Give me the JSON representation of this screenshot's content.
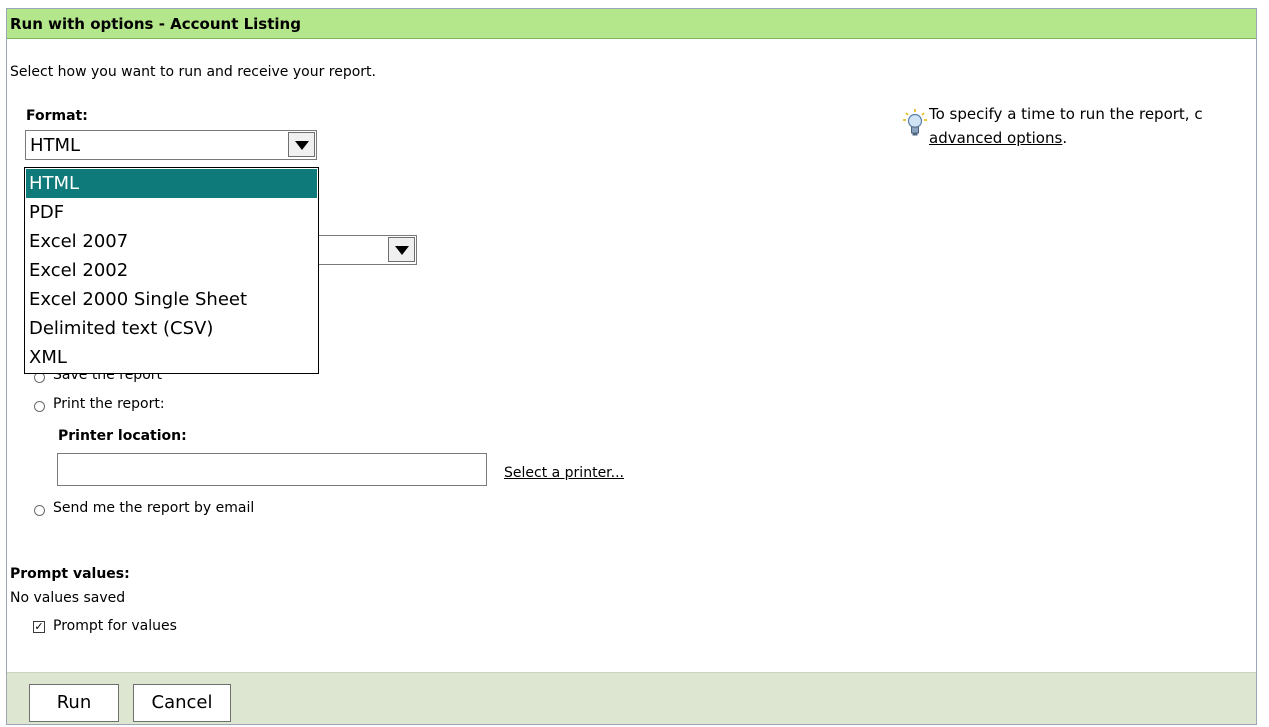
{
  "dialog": {
    "title": "Run with options - Account Listing",
    "instruction": "Select how you want to run and receive your report."
  },
  "format": {
    "label": "Format:",
    "selected": "HTML",
    "options": [
      "HTML",
      "PDF",
      "Excel 2007",
      "Excel 2002",
      "Excel 2000 Single Sheet",
      "Delimited text (CSV)",
      "XML"
    ]
  },
  "tip": {
    "line1": "To specify a time to run the report, c",
    "link": "advanced options",
    "after": "."
  },
  "delivery": {
    "save_label": "Save the report",
    "print_label": "Print the report:",
    "printer_location_label": "Printer location:",
    "printer_location_value": "",
    "select_printer_link": "Select a printer...",
    "email_label": "Send me the report by email"
  },
  "prompt": {
    "heading": "Prompt values:",
    "status": "No values saved",
    "checkbox_label": "Prompt for values",
    "checked": true
  },
  "buttons": {
    "run": "Run",
    "cancel": "Cancel"
  }
}
